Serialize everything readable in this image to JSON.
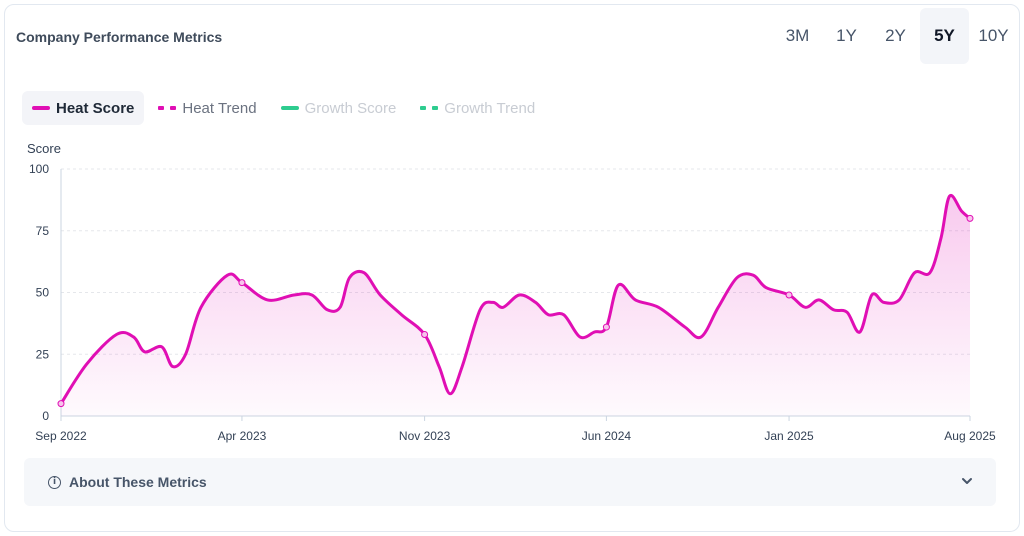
{
  "header": {
    "title": "Company Performance Metrics",
    "ranges": [
      "3M",
      "1Y",
      "2Y",
      "5Y",
      "10Y"
    ],
    "active_range": "5Y"
  },
  "legend": [
    {
      "label": "Heat Score",
      "style": "solid",
      "color": "#e00fb4",
      "state": "active"
    },
    {
      "label": "Heat Trend",
      "style": "dashed",
      "color": "#e00fb4",
      "state": "plain"
    },
    {
      "label": "Growth Score",
      "style": "solid",
      "color": "#2ecc8f",
      "state": "inactive"
    },
    {
      "label": "Growth Trend",
      "style": "dashed",
      "color": "#2ecc8f",
      "state": "inactive"
    }
  ],
  "about": {
    "label": "About These Metrics"
  },
  "colors": {
    "heat": "#e00fb4",
    "growth": "#2ecc8f",
    "grid": "#e5e7eb",
    "axis": "#94a3b8"
  },
  "chart_data": {
    "type": "line",
    "ylabel": "Score",
    "ylim": [
      0,
      100
    ],
    "yticks": [
      0,
      25,
      50,
      75,
      100
    ],
    "x_start": "2022-09",
    "x_end": "2025-08",
    "xticks": [
      {
        "label": "Sep 2022",
        "date": "2022-09"
      },
      {
        "label": "Apr 2023",
        "date": "2023-04"
      },
      {
        "label": "Nov 2023",
        "date": "2023-11"
      },
      {
        "label": "Jun 2024",
        "date": "2024-06"
      },
      {
        "label": "Jan 2025",
        "date": "2025-01"
      },
      {
        "label": "Aug 2025",
        "date": "2025-08"
      }
    ],
    "grid": true,
    "area_fill": true,
    "series": [
      {
        "name": "Heat Score",
        "points": [
          {
            "x": "2022-09-01",
            "y": 5,
            "marker": true
          },
          {
            "x": "2022-10-01",
            "y": 21
          },
          {
            "x": "2022-11-05",
            "y": 33
          },
          {
            "x": "2022-11-25",
            "y": 32
          },
          {
            "x": "2022-12-08",
            "y": 26
          },
          {
            "x": "2022-12-28",
            "y": 28
          },
          {
            "x": "2023-01-10",
            "y": 20
          },
          {
            "x": "2023-01-25",
            "y": 25
          },
          {
            "x": "2023-02-12",
            "y": 44
          },
          {
            "x": "2023-03-15",
            "y": 57
          },
          {
            "x": "2023-04-01",
            "y": 54,
            "marker": true
          },
          {
            "x": "2023-05-01",
            "y": 47
          },
          {
            "x": "2023-06-01",
            "y": 49
          },
          {
            "x": "2023-06-22",
            "y": 49
          },
          {
            "x": "2023-07-10",
            "y": 43
          },
          {
            "x": "2023-07-25",
            "y": 44
          },
          {
            "x": "2023-08-05",
            "y": 56
          },
          {
            "x": "2023-08-22",
            "y": 58
          },
          {
            "x": "2023-09-10",
            "y": 49
          },
          {
            "x": "2023-10-05",
            "y": 41
          },
          {
            "x": "2023-11-01",
            "y": 33,
            "marker": true
          },
          {
            "x": "2023-11-18",
            "y": 20
          },
          {
            "x": "2023-12-01",
            "y": 9
          },
          {
            "x": "2023-12-15",
            "y": 20
          },
          {
            "x": "2024-01-05",
            "y": 43
          },
          {
            "x": "2024-01-20",
            "y": 46
          },
          {
            "x": "2024-02-01",
            "y": 44
          },
          {
            "x": "2024-02-20",
            "y": 49
          },
          {
            "x": "2024-03-10",
            "y": 46
          },
          {
            "x": "2024-03-25",
            "y": 41
          },
          {
            "x": "2024-04-12",
            "y": 41
          },
          {
            "x": "2024-05-01",
            "y": 32
          },
          {
            "x": "2024-05-18",
            "y": 34
          },
          {
            "x": "2024-06-01",
            "y": 36,
            "marker": true
          },
          {
            "x": "2024-06-15",
            "y": 53
          },
          {
            "x": "2024-07-05",
            "y": 47
          },
          {
            "x": "2024-08-01",
            "y": 44
          },
          {
            "x": "2024-09-01",
            "y": 36
          },
          {
            "x": "2024-09-20",
            "y": 32
          },
          {
            "x": "2024-10-10",
            "y": 44
          },
          {
            "x": "2024-11-01",
            "y": 56
          },
          {
            "x": "2024-11-20",
            "y": 57
          },
          {
            "x": "2024-12-05",
            "y": 52
          },
          {
            "x": "2025-01-01",
            "y": 49,
            "marker": true
          },
          {
            "x": "2025-01-20",
            "y": 44
          },
          {
            "x": "2025-02-05",
            "y": 47
          },
          {
            "x": "2025-02-22",
            "y": 43
          },
          {
            "x": "2025-03-10",
            "y": 42
          },
          {
            "x": "2025-03-25",
            "y": 34
          },
          {
            "x": "2025-04-08",
            "y": 49
          },
          {
            "x": "2025-04-22",
            "y": 46
          },
          {
            "x": "2025-05-10",
            "y": 47
          },
          {
            "x": "2025-05-28",
            "y": 58
          },
          {
            "x": "2025-06-15",
            "y": 58
          },
          {
            "x": "2025-06-28",
            "y": 72
          },
          {
            "x": "2025-07-08",
            "y": 89
          },
          {
            "x": "2025-07-22",
            "y": 83
          },
          {
            "x": "2025-08-01",
            "y": 80,
            "marker": true
          }
        ]
      }
    ]
  }
}
